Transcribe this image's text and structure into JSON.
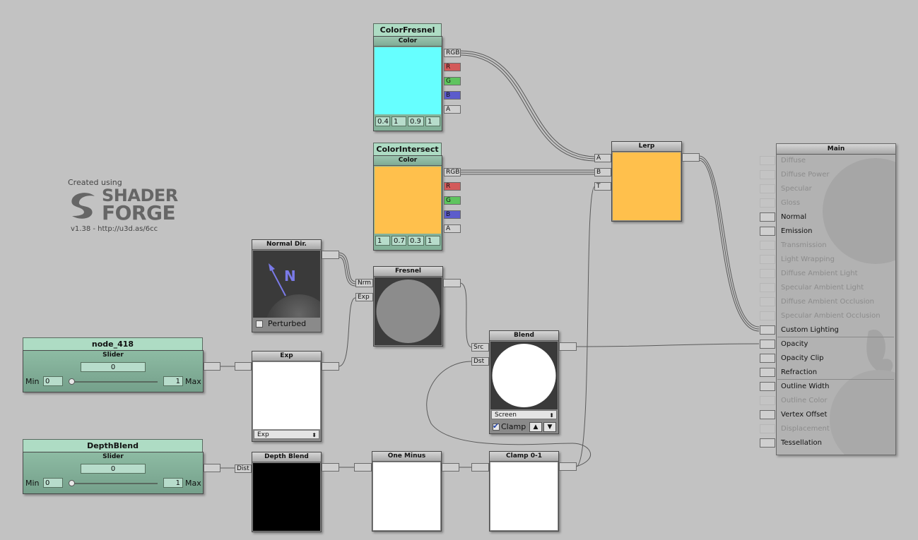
{
  "branding": {
    "created_using": "Created using",
    "logo_text_1": "SHADER",
    "logo_text_2": "FORGE",
    "version": "v1.38 - http://u3d.as/6cc"
  },
  "nodes": {
    "color_fresnel": {
      "name": "ColorFresnel",
      "type": "Color",
      "swatch": "#66ffff",
      "values": [
        "0.4",
        "1",
        "0.9",
        "1"
      ],
      "outputs": [
        "RGB",
        "R",
        "G",
        "B",
        "A"
      ]
    },
    "color_intersect": {
      "name": "ColorIntersect",
      "type": "Color",
      "swatch": "#ffc04c",
      "values": [
        "1",
        "0.7",
        "0.3",
        "1"
      ],
      "outputs": [
        "RGB",
        "R",
        "G",
        "B",
        "A"
      ]
    },
    "lerp": {
      "title": "Lerp",
      "inputs": [
        "A",
        "B",
        "T"
      ],
      "swatch": "#ffc04c"
    },
    "normal_dir": {
      "title": "Normal Dir.",
      "symbol": "N",
      "perturbed_label": "Perturbed",
      "perturbed": false
    },
    "fresnel": {
      "title": "Fresnel",
      "inputs": [
        "Nrm",
        "Exp"
      ]
    },
    "blend": {
      "title": "Blend",
      "inputs": [
        "Src",
        "Dst"
      ],
      "mode": "Screen",
      "clamp_label": "Clamp",
      "clamp": true,
      "up": "▲",
      "down": "▼"
    },
    "exp": {
      "title": "Exp",
      "mode": "Exp"
    },
    "depth_blend": {
      "title": "Depth Blend",
      "inputs": [
        "Dist"
      ]
    },
    "one_minus": {
      "title": "One Minus"
    },
    "clamp01": {
      "title": "Clamp 0-1"
    },
    "node_418": {
      "name": "node_418",
      "type": "Slider",
      "value": "0",
      "min_label": "Min",
      "min": "0",
      "max": "1",
      "max_label": "Max"
    },
    "depthblend_slider": {
      "name": "DepthBlend",
      "type": "Slider",
      "value": "0",
      "min_label": "Min",
      "min": "0",
      "max": "1",
      "max_label": "Max"
    }
  },
  "main": {
    "title": "Main",
    "inputs": [
      {
        "label": "Diffuse",
        "active": false
      },
      {
        "label": "Diffuse Power",
        "active": false
      },
      {
        "label": "Specular",
        "active": false
      },
      {
        "label": "Gloss",
        "active": false
      },
      {
        "label": "Normal",
        "active": true
      },
      {
        "label": "Emission",
        "active": true
      },
      {
        "label": "Transmission",
        "active": false
      },
      {
        "label": "Light Wrapping",
        "active": false
      },
      {
        "label": "Diffuse Ambient Light",
        "active": false
      },
      {
        "label": "Specular Ambient Light",
        "active": false
      },
      {
        "label": "Diffuse Ambient Occlusion",
        "active": false
      },
      {
        "label": "Specular Ambient Occlusion",
        "active": false
      },
      {
        "label": "Custom Lighting",
        "active": true
      },
      {
        "label": "Opacity",
        "active": true
      },
      {
        "label": "Opacity Clip",
        "active": true
      },
      {
        "label": "Refraction",
        "active": true
      },
      {
        "label": "Outline Width",
        "active": true
      },
      {
        "label": "Outline Color",
        "active": false
      },
      {
        "label": "Vertex Offset",
        "active": true
      },
      {
        "label": "Displacement",
        "active": false
      },
      {
        "label": "Tessellation",
        "active": true
      }
    ]
  },
  "colors": {
    "canvas": "#c2c2c2",
    "property_green": "#aedcc4",
    "cyan": "#66ffff",
    "orange": "#ffc04c"
  }
}
